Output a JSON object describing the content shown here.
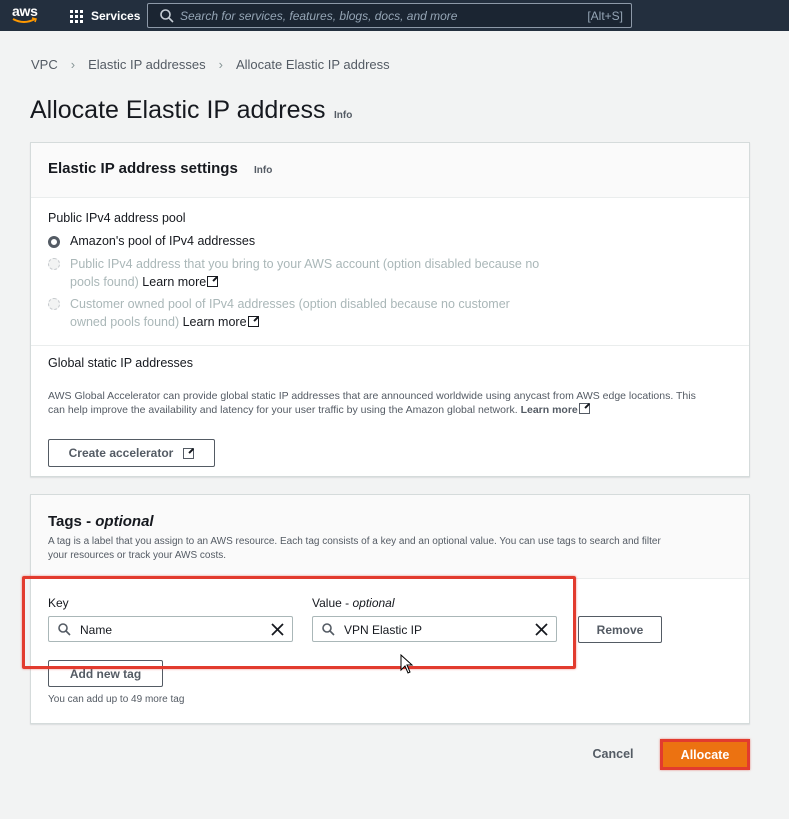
{
  "topnav": {
    "logo_text": "aws",
    "services_label": "Services",
    "search_placeholder": "Search for services, features, blogs, docs, and more",
    "search_shortcut": "[Alt+S]"
  },
  "breadcrumb": [
    "VPC",
    "Elastic IP addresses",
    "Allocate Elastic IP address"
  ],
  "page": {
    "title": "Allocate Elastic IP address",
    "info": "Info"
  },
  "settings": {
    "title": "Elastic IP address settings",
    "info": "Info",
    "pool_label": "Public IPv4 address pool",
    "options": [
      {
        "line1": "Amazon's pool of IPv4 addresses",
        "line2": "",
        "learn": "",
        "selected": true,
        "disabled": false
      },
      {
        "line1": "Public IPv4 address that you bring to your AWS account (option disabled because no",
        "line2": "pools found)",
        "learn": "Learn more",
        "selected": false,
        "disabled": true
      },
      {
        "line1": "Customer owned pool of IPv4 addresses (option disabled because no customer",
        "line2": "owned pools found)",
        "learn": "Learn more",
        "selected": false,
        "disabled": true
      }
    ],
    "global_label": "Global static IP addresses",
    "global_desc_1": "AWS Global Accelerator can provide global static IP addresses that are announced worldwide using anycast from AWS edge locations. This",
    "global_desc_2": "can help improve the availability and latency for your user traffic by using the Amazon global network.",
    "global_learn": "Learn more",
    "create_accelerator": "Create accelerator"
  },
  "tags": {
    "title": "Tags",
    "title_optional": "optional",
    "desc_1": "A tag is a label that you assign to an AWS resource. Each tag consists of a key and an optional value. You can use tags to search and filter",
    "desc_2": "your resources or track your AWS costs.",
    "key_label": "Key",
    "value_label": "Value",
    "value_optional": "optional",
    "key_value": "Name",
    "value_value": "VPN Elastic IP",
    "remove": "Remove",
    "add_new_tag": "Add new tag",
    "limit_text": "You can add up to 49 more tag"
  },
  "footer": {
    "cancel": "Cancel",
    "allocate": "Allocate"
  },
  "colors": {
    "nav_bg": "#232f3e",
    "primary": "#ec7211",
    "highlight": "#e23b2e"
  }
}
